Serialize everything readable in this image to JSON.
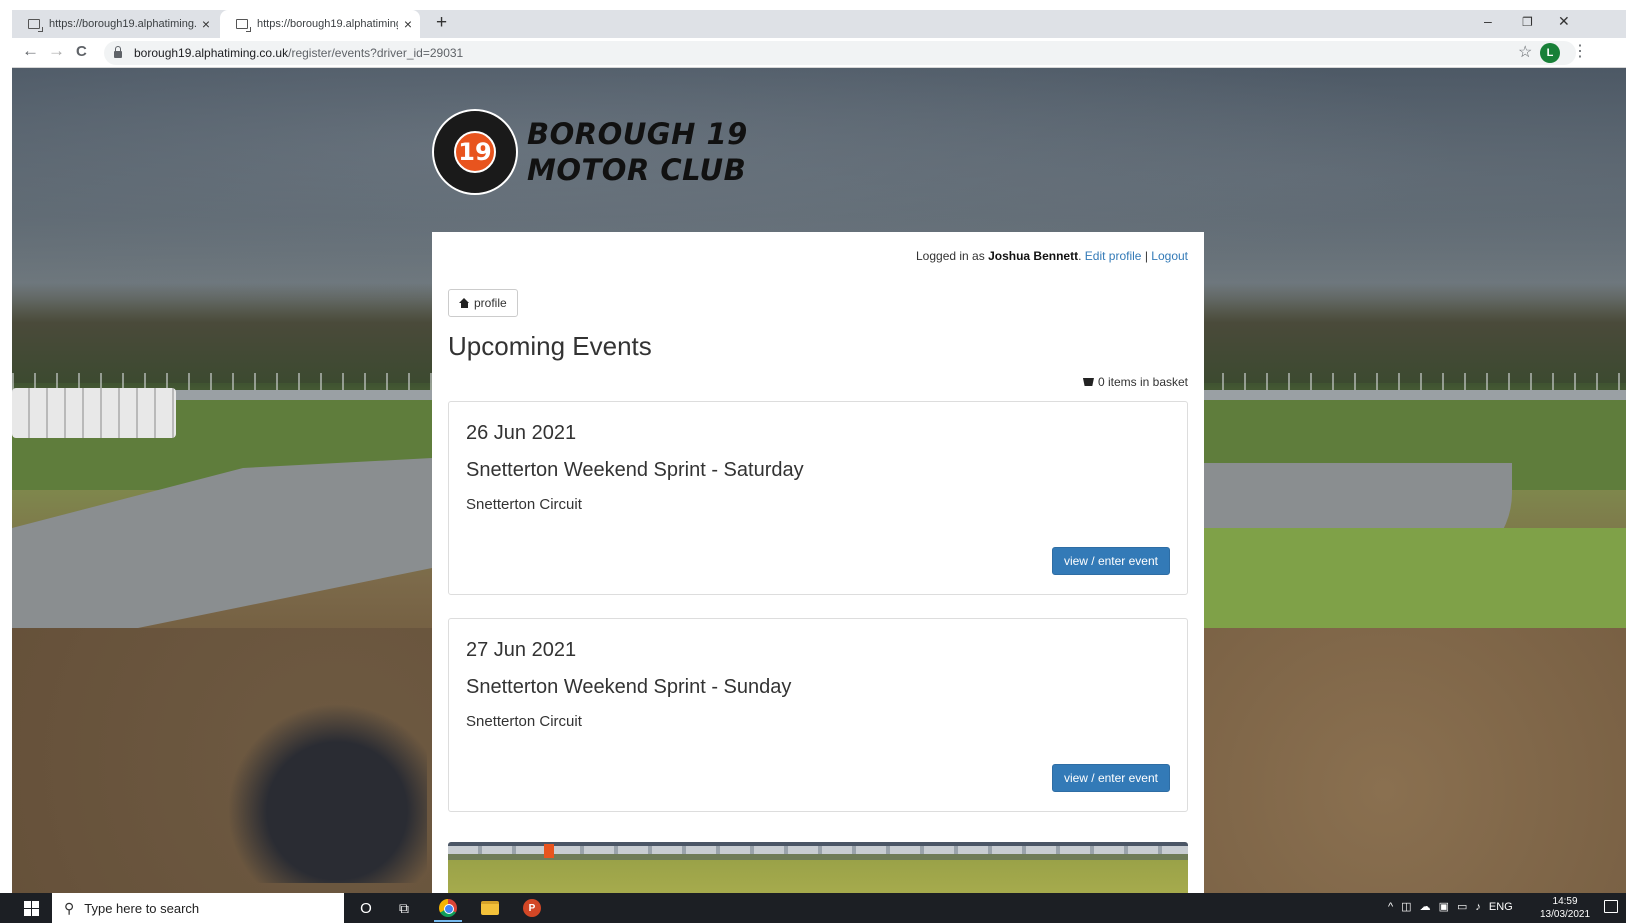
{
  "browser": {
    "tabs": [
      {
        "title": "https://borough19.alphatiming.c",
        "close": "×"
      },
      {
        "title": "https://borough19.alphatiming.c",
        "close": "×"
      }
    ],
    "new_tab": "+",
    "window_controls": {
      "minimize": "–",
      "restore": "❐",
      "close": "✕"
    },
    "nav": {
      "back": "←",
      "forward": "→",
      "reload": "C"
    },
    "url_host": "borough19.alphatiming.co.uk",
    "url_path": "/register/events?driver_id=29031",
    "star": "☆",
    "profile_initial": "L",
    "menu": "⋮"
  },
  "site": {
    "logo_number": "19",
    "logo_line1": "BOROUGH 19",
    "logo_line2": "MOTOR CLUB"
  },
  "account": {
    "logged_in_prefix": "Logged in as",
    "user_name": "Joshua Bennett",
    "separator_dot": ".",
    "edit_profile": "Edit profile",
    "pipe": "|",
    "logout": "Logout"
  },
  "profile_button": "profile",
  "page_title": "Upcoming Events",
  "basket_text": "0 items in basket",
  "events": [
    {
      "date": "26 Jun 2021",
      "name": "Snetterton Weekend Sprint - Saturday",
      "venue": "Snetterton Circuit",
      "button": "view / enter event"
    },
    {
      "date": "27 Jun 2021",
      "name": "Snetterton Weekend Sprint - Sunday",
      "venue": "Snetterton Circuit",
      "button": "view / enter event"
    }
  ],
  "taskbar": {
    "search_placeholder": "Type here to search",
    "cortana": "O",
    "task_view": "⧉",
    "tray_caret": "^",
    "language": "ENG",
    "time": "14:59",
    "date": "13/03/2021"
  },
  "colors": {
    "link": "#337ab7",
    "primary_button": "#337ab7",
    "logo_orange": "#e8541e"
  }
}
